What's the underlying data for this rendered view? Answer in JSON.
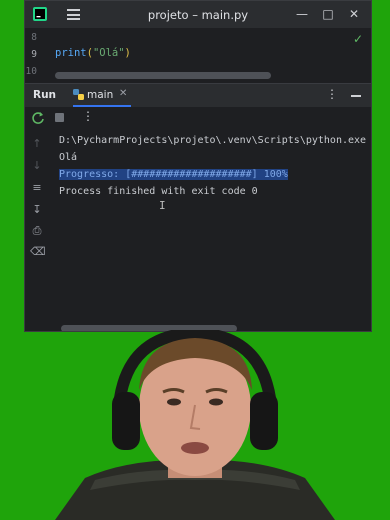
{
  "window": {
    "title": "projeto – main.py",
    "minimize_icon": "minimize-icon",
    "maximize_icon": "maximize-icon",
    "close_icon": "close-icon"
  },
  "editor": {
    "lines": [
      {
        "number": "8",
        "code": ""
      },
      {
        "number": "9",
        "code": ""
      },
      {
        "number": "10",
        "code": ""
      }
    ],
    "code_func": "print",
    "code_paren_open": "(",
    "code_string": "\"Olá\"",
    "code_paren_close": ")"
  },
  "run_panel": {
    "label": "Run",
    "tab_label": "main",
    "console": {
      "line1": "D:\\PycharmProjects\\projeto\\.venv\\Scripts\\python.exe",
      "line2": "Olá",
      "line3": "Progresso: [####################] 100%",
      "line4": "Process finished with exit code 0"
    }
  },
  "colors": {
    "background": "#1fa40b",
    "accent": "#3574f0",
    "keyword": "#56a8f5",
    "string": "#6aab73"
  }
}
